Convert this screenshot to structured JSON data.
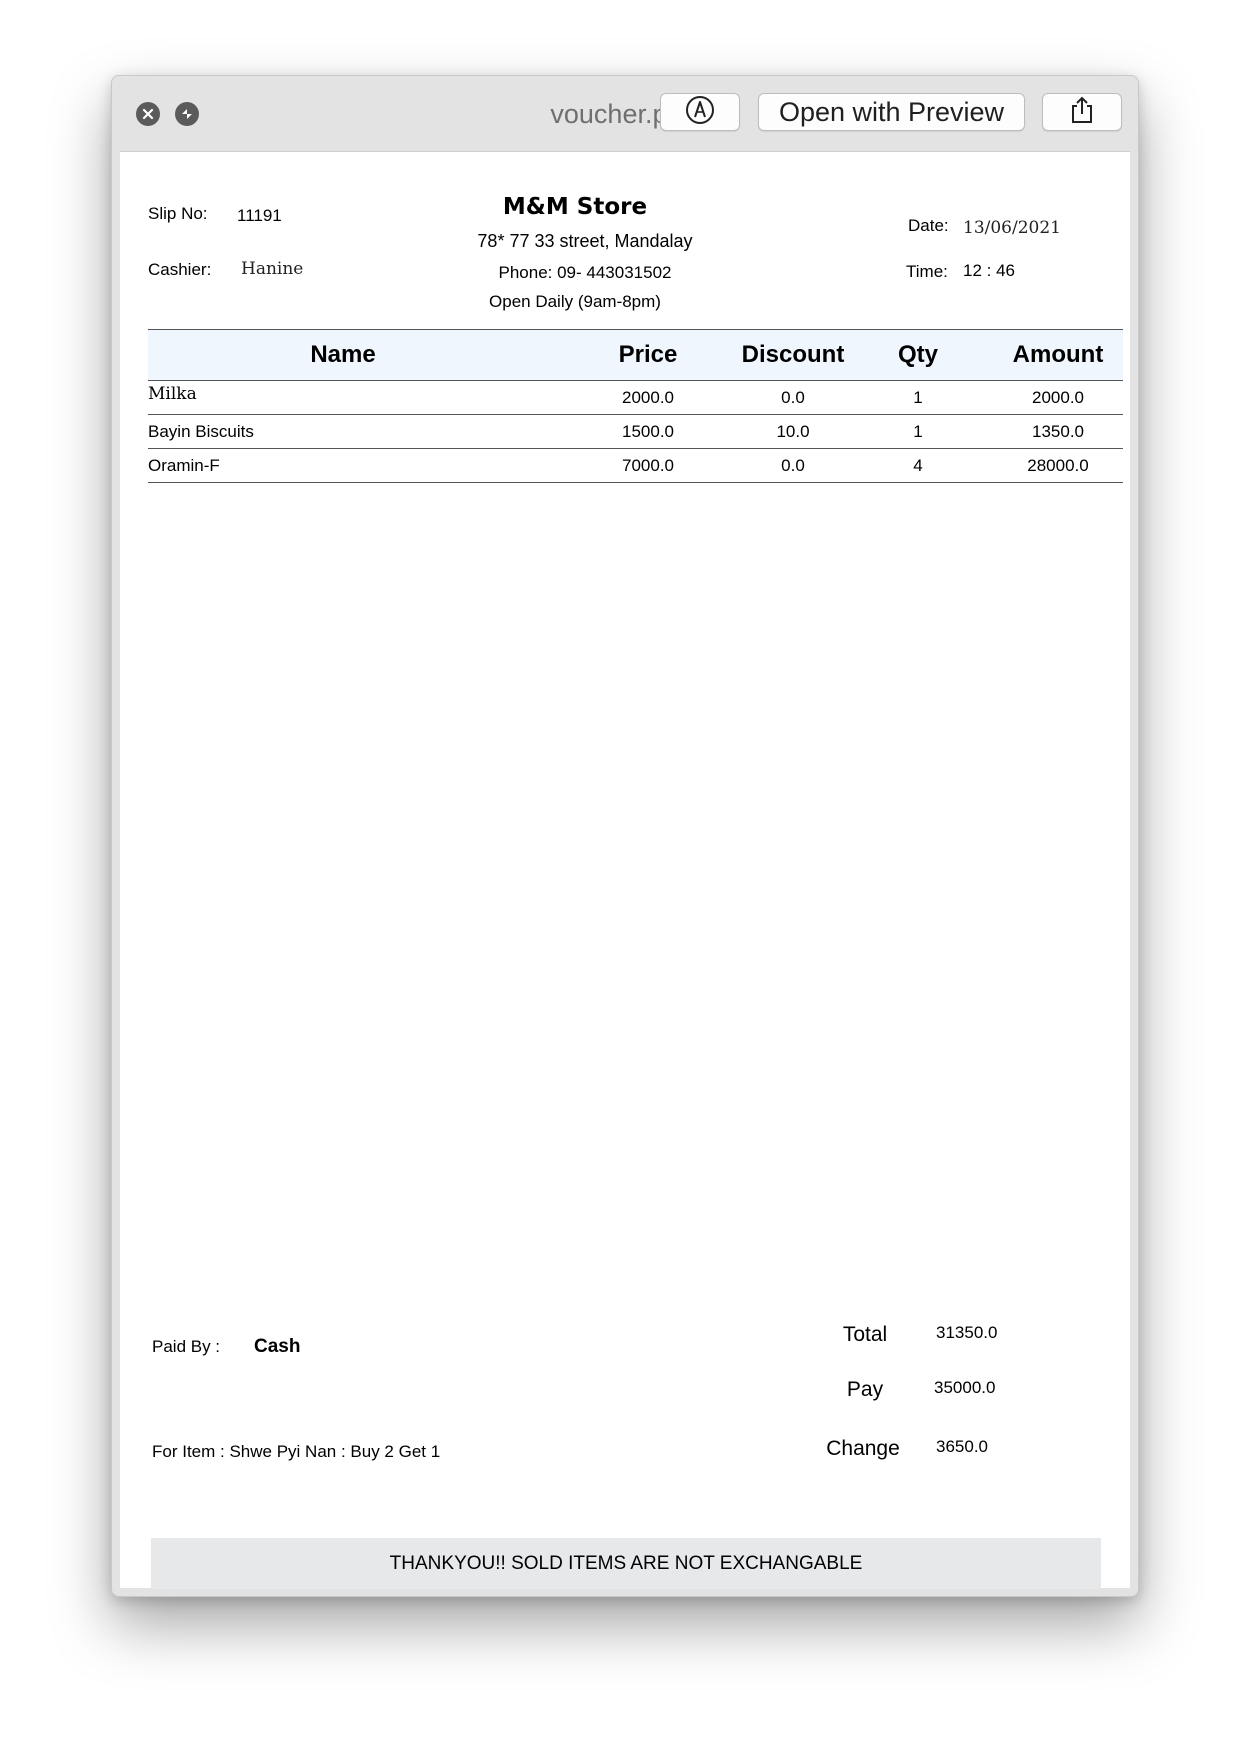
{
  "window": {
    "title": "voucher.pdf",
    "open_with_preview_label": "Open with Preview",
    "icons": {
      "close": "close-icon",
      "minimize": "minimize-icon",
      "markup": "markup-pen-icon",
      "share": "share-icon"
    }
  },
  "receipt": {
    "slip_label": "Slip No:",
    "slip_no": "11191",
    "cashier_label": "Cashier:",
    "cashier": "Hanine",
    "store_name": "M&M Store",
    "address": "78* 77 33 street, Mandalay",
    "phone": "Phone: 09- 443031502",
    "hours": "Open Daily (9am-8pm)",
    "date_label": "Date:",
    "date": "13/06/2021",
    "time_label": "Time:",
    "time": "12 : 46",
    "columns": [
      "Name",
      "Price",
      "Discount",
      "Qty",
      "Amount"
    ],
    "items": [
      {
        "name": "Milka",
        "price": "2000.0",
        "discount": "0.0",
        "qty": "1",
        "amount": "2000.0"
      },
      {
        "name": "Bayin Biscuits",
        "price": "1500.0",
        "discount": "10.0",
        "qty": "1",
        "amount": "1350.0"
      },
      {
        "name": "Oramin-F",
        "price": "7000.0",
        "discount": "0.0",
        "qty": "4",
        "amount": "28000.0"
      }
    ],
    "paid_by_label": "Paid By :",
    "paid_by": "Cash",
    "promo": "For Item : Shwe Pyi Nan : Buy 2 Get 1",
    "total_label": "Total",
    "total": "31350.0",
    "pay_label": "Pay",
    "pay": "35000.0",
    "change_label": "Change",
    "change": "3650.0",
    "footer_note": "THANKYOU!! SOLD ITEMS ARE NOT EXCHANGABLE"
  }
}
